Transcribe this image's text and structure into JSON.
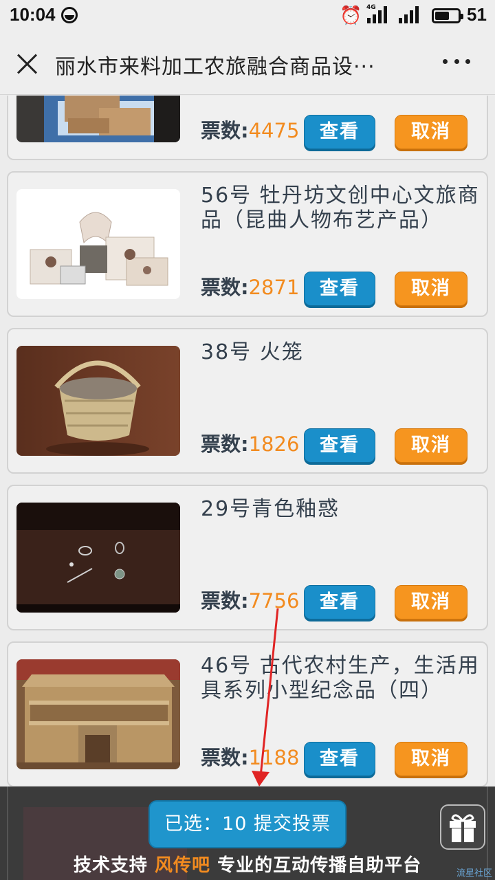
{
  "status": {
    "time": "10:04",
    "network": "4G",
    "battery": "51"
  },
  "header": {
    "close_icon": "close-icon",
    "title": "丽水市来料加工农旅融合商品设···",
    "more_icon": "more-icon"
  },
  "labels": {
    "votes": "票数:",
    "view": "查看",
    "cancel": "取消"
  },
  "items": [
    {
      "name": "",
      "votes": "4475"
    },
    {
      "name": "56号 牡丹坊文创中心文旅商品（昆曲人物布艺产品）",
      "votes": "2871"
    },
    {
      "name": "38号 火笼",
      "votes": "1826"
    },
    {
      "name": "29号青色釉惑",
      "votes": "7756"
    },
    {
      "name": "46号 古代农村生产，生活用具系列小型纪念品（四）",
      "votes": "1188"
    }
  ],
  "footer": {
    "submit_label": "已选：10  提交投票",
    "support_prefix": "技术支持",
    "support_brand": "风传吧",
    "support_suffix": "专业的互动传播自助平台",
    "gift_icon": "gift-icon",
    "watermark": "流星社区"
  },
  "colors": {
    "accent_blue": "#1a8fca",
    "accent_orange": "#f6951f",
    "vote_number": "#f28b1f"
  }
}
